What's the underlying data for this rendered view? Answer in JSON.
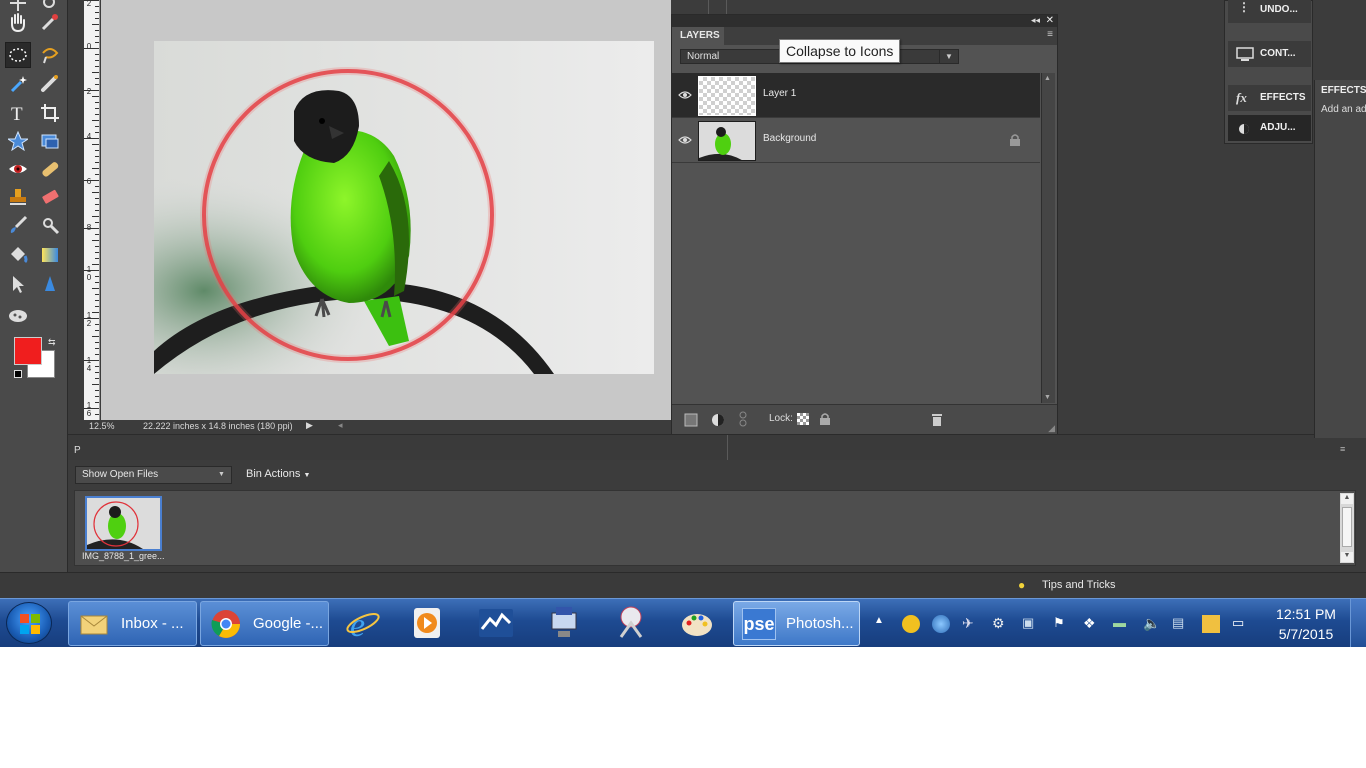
{
  "canvas": {
    "zoom": "12.5%",
    "doc_size": "22.222 inches x 14.8 inches (180 ppi)",
    "ruler_labels": [
      "2",
      "0",
      "2",
      "4",
      "6",
      "8",
      "1\n0",
      "1\n2",
      "1\n4",
      "1\n6"
    ]
  },
  "layers_panel": {
    "tab_label": "LAYERS",
    "blend_mode": "Normal",
    "tooltip": "Collapse to Icons",
    "layers": [
      {
        "name": "Layer 1",
        "active": true
      },
      {
        "name": "Background",
        "active": false,
        "locked": true
      }
    ],
    "lock_label": "Lock:"
  },
  "right_panels": {
    "buttons": [
      {
        "label": "UNDO...",
        "icon": "undo-history-icon"
      },
      {
        "label": "CONT...",
        "icon": "content-icon"
      },
      {
        "label": "EFFECTS",
        "icon": "fx-icon"
      },
      {
        "label": "ADJU...",
        "icon": "adjustments-icon"
      }
    ],
    "effects_title": "EFFECTS",
    "effects_text": "Add an ad"
  },
  "project_bin": {
    "show_files": "Show Open Files",
    "bin_actions": "Bin Actions",
    "file_name": "IMG_8788_1_gree..."
  },
  "status": {
    "tips": "Tips and Tricks"
  },
  "taskbar": {
    "buttons": [
      {
        "label": "Inbox - ...",
        "icon": "outlook-icon"
      },
      {
        "label": "Google -...",
        "icon": "chrome-icon"
      },
      {
        "label": "Photosh...",
        "icon": "pse-icon"
      }
    ],
    "pse_icon_text": "pse",
    "time": "12:51 PM",
    "date": "5/7/2015"
  }
}
